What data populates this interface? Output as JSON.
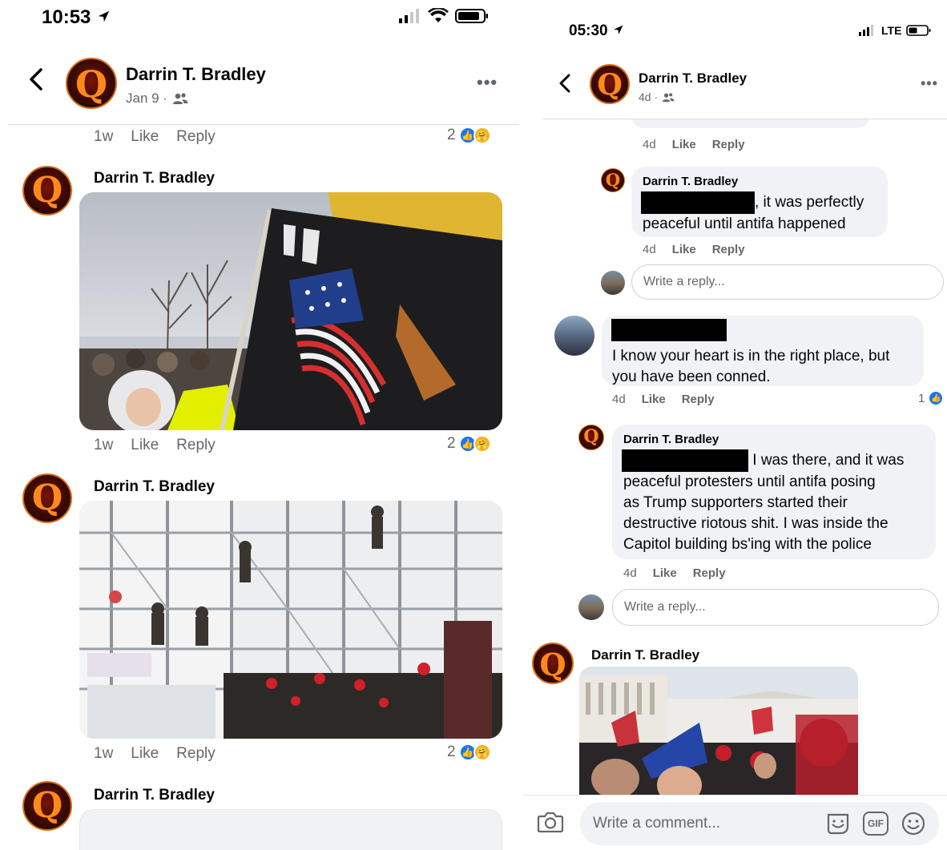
{
  "left": {
    "status": {
      "time": "10:53"
    },
    "header": {
      "name": "Darrin T. Bradley",
      "date": "Jan 9 ·"
    },
    "comments": [
      {
        "time": "1w",
        "like": "Like",
        "reply": "Reply",
        "count": "2"
      },
      {
        "name": "Darrin T. Bradley",
        "time": "1w",
        "like": "Like",
        "reply": "Reply",
        "count": "2"
      },
      {
        "name": "Darrin T. Bradley",
        "time": "1w",
        "like": "Like",
        "reply": "Reply",
        "count": "2"
      },
      {
        "name": "Darrin T. Bradley"
      }
    ]
  },
  "right": {
    "status": {
      "time": "05:30",
      "network": "LTE"
    },
    "header": {
      "name": "Darrin T. Bradley",
      "date": "4d ·"
    },
    "top_row": {
      "time": "4d",
      "like": "Like",
      "reply": "Reply"
    },
    "reply1": {
      "name": "Darrin T. Bradley",
      "text1": ", it was perfectly",
      "text2": "peaceful until antifa happened",
      "time": "4d",
      "like": "Like",
      "reply": "Reply"
    },
    "write_reply": "Write a reply...",
    "comment2": {
      "text1": "I know your heart is in the right place, but",
      "text2": "you have been conned.",
      "time": "4d",
      "like": "Like",
      "reply": "Reply",
      "reactions": "1"
    },
    "reply2": {
      "name": "Darrin T. Bradley",
      "text1": " I was there, and it was",
      "text2": "peaceful protesters until antifa posing",
      "text3": "as Trump supporters started their",
      "text4": "destructive riotous shit. I was inside the",
      "text5": "Capitol building bs'ing with the police",
      "time": "4d",
      "like": "Like",
      "reply": "Reply"
    },
    "comment3": {
      "name": "Darrin T. Bradley"
    },
    "composer": {
      "placeholder": "Write a comment...",
      "gif": "GIF"
    }
  },
  "colors": {
    "facebook_blue": "#1877f2",
    "care_yellow": "#f7b125",
    "bubble_gray": "#f0f2f5",
    "meta_gray": "#65676b"
  }
}
